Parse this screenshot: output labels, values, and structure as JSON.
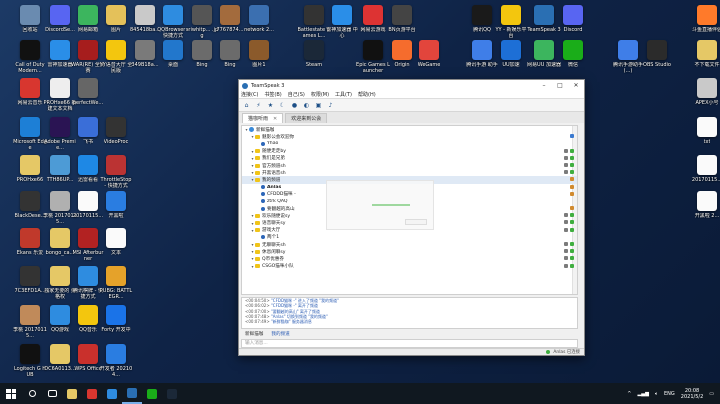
{
  "desktop": {
    "icons": [
      {
        "label": "回收站",
        "color": "#6a8bb0"
      },
      {
        "label": "DiscordSe...",
        "color": "#5865F2"
      },
      {
        "label": "网易邮箱",
        "color": "#3cb55e"
      },
      {
        "label": "图片",
        "color": "#e4c15a"
      },
      {
        "label": "845418ba...",
        "color": "#c9c9c9"
      },
      {
        "label": "QQBrowser - 快捷方式",
        "color": "#2e8ce0"
      },
      {
        "label": "sriwhitp... .jpg",
        "color": "#555"
      },
      {
        "label": "7767874...",
        "color": "#a36b3d"
      },
      {
        "label": "network 2...",
        "color": "#3b6fb0"
      },
      {
        "label": "Battlestate Games L...",
        "color": "#333"
      },
      {
        "label": "雷神加速器 中心",
        "color": "#2a8ee8"
      },
      {
        "label": "网易云游戏",
        "color": "#d33"
      },
      {
        "label": "BN页游平台",
        "color": "#444"
      },
      {
        "label": "腾讯QQ",
        "color": "#1a1a1a"
      },
      {
        "label": "YY - 新娱乐平台",
        "color": "#f3c60e"
      },
      {
        "label": "TeamSpeak 3",
        "color": "#2a6fb3"
      },
      {
        "label": "Discord",
        "color": "#5865F2"
      },
      {
        "label": "斗鱼直播伴侣",
        "color": "#ff7a2a"
      },
      {
        "label": "Call of Duty Modern...",
        "color": "#111"
      },
      {
        "label": "雷神加速器",
        "color": "#2a8ee8"
      },
      {
        "label": "WAR(RE) 全民赛",
        "color": "#a61d1d"
      },
      {
        "label": "YY语音大厅 全民版",
        "color": "#f3c60e"
      },
      {
        "label": "349B18a...",
        "color": "#7a7a7a"
      },
      {
        "label": "桌面",
        "color": "#2277cc"
      },
      {
        "label": "Bing",
        "color": "#6b6b6b"
      },
      {
        "label": "Bing",
        "color": "#6b6b6b"
      },
      {
        "label": "图片1",
        "color": "#8b5a2b"
      },
      {
        "label": "Steam",
        "color": "#1b2838"
      },
      {
        "label": "Epic Games Launcher",
        "color": "#111"
      },
      {
        "label": "Origin",
        "color": "#f56c2d"
      },
      {
        "label": "WeGame",
        "color": "#e2453c"
      },
      {
        "label": "腾讯手游 助手",
        "color": "#3f7ee8"
      },
      {
        "label": "UU加速",
        "color": "#1d6fd6"
      },
      {
        "label": "网易UU 加速器",
        "color": "#3cb55e"
      },
      {
        "label": "微信",
        "color": "#1aad19"
      },
      {
        "label": "腾讯手游助手(...)",
        "color": "#3f7ee8"
      },
      {
        "label": "OBS Studio",
        "color": "#2b2b2b"
      },
      {
        "label": "不下载文件",
        "color": "#e5c866"
      },
      {
        "label": "网易云音乐",
        "color": "#d8362f"
      },
      {
        "label": "PROHxe66 新建文本文档",
        "color": "#eeeeee"
      },
      {
        "label": "perfectWe...",
        "color": "#666"
      },
      {
        "label": "APEX小号",
        "color": "#c9c9c9"
      },
      {
        "label": "Microsoft Edge",
        "color": "#1d7fd6"
      },
      {
        "label": "Adobe Premie...",
        "color": "#2a1453"
      },
      {
        "label": "飞书",
        "color": "#3a6ed8"
      },
      {
        "label": "VideoProc",
        "color": "#333"
      },
      {
        "label": "txt",
        "color": "#fafafa"
      },
      {
        "label": "PROHxe66",
        "color": "#e5c866"
      },
      {
        "label": "TTH86UP...",
        "color": "#4d9bd6"
      },
      {
        "label": "迅雷看看",
        "color": "#1e88e5"
      },
      {
        "label": "ThrottleStop - 快捷方式",
        "color": "#b33"
      },
      {
        "label": "20170115...",
        "color": "#fafafa"
      },
      {
        "label": "BlackDese...",
        "color": "#333"
      },
      {
        "label": "李桃 20170115...",
        "color": "#b0b0b0"
      },
      {
        "label": "20170115...",
        "color": "#fafafa"
      },
      {
        "label": "开黑啦",
        "color": "#2a7de1"
      },
      {
        "label": "开黑啦 2...",
        "color": "#fafafa"
      },
      {
        "label": "Ekans 乐爱",
        "color": "#c0392b"
      },
      {
        "label": "bongo_ca...",
        "color": "#e5c866"
      },
      {
        "label": "MSI Afterburner",
        "color": "#b22222"
      },
      {
        "label": "文本",
        "color": "#fafafa"
      },
      {
        "label": "7C3EFD1A...",
        "color": "#333"
      },
      {
        "label": "独家无要的 资格权",
        "color": "#e5c866"
      },
      {
        "label": "腾讯棋牌 - 快捷方式",
        "color": "#2e8ce0"
      },
      {
        "label": "PUBG: BATTLEGR...",
        "color": "#e5a22a"
      },
      {
        "label": "李桃 20170115...",
        "color": "#c08a5a"
      },
      {
        "label": "QQ游戏",
        "color": "#2e8ce0"
      },
      {
        "label": "QQ音乐",
        "color": "#f3c60e"
      },
      {
        "label": "Forty 开发中",
        "color": "#1a73e8"
      },
      {
        "label": "Logitech G HUB",
        "color": "#111"
      },
      {
        "label": "DC6A0113...",
        "color": "#e5c866"
      },
      {
        "label": "WPS Office",
        "color": "#c9302c"
      },
      {
        "label": "开发者 202104...",
        "color": "#2a7de1"
      }
    ]
  },
  "window": {
    "title": "TeamSpeak 3",
    "menu": [
      "连接(C)",
      "书签(B)",
      "自己(S)",
      "权限(M)",
      "工具(T)",
      "帮助(H)"
    ],
    "tabs": [
      {
        "label": "猫咖听雨",
        "active": true
      },
      {
        "label": "欢迎来到公会",
        "active": false
      }
    ],
    "tree": [
      {
        "type": "server",
        "label": "新鲜猫咖",
        "bold": false
      },
      {
        "type": "channel",
        "label": "魅影公会欢迎你",
        "flags": [
          "info"
        ]
      },
      {
        "type": "user",
        "label": "Yhao",
        "indent": 2
      },
      {
        "type": "channel",
        "label": "随便走走by",
        "flags": [
          "lock",
          "ok"
        ]
      },
      {
        "type": "channel",
        "label": "我们是兄弟",
        "flags": [
          "lock",
          "ok"
        ]
      },
      {
        "type": "channel",
        "label": "官方频道sh",
        "flags": [
          "lock",
          "ok"
        ]
      },
      {
        "type": "channel",
        "label": "开黑语音sh",
        "flags": [
          "lock",
          "ok"
        ]
      },
      {
        "type": "channel",
        "label": "我的频道",
        "selected": true,
        "flags": [
          "mod"
        ]
      },
      {
        "type": "user",
        "label": "Anlas",
        "indent": 2,
        "bold": true,
        "flags": [
          "mod"
        ]
      },
      {
        "type": "user",
        "label": "CFDDD猫咪 -",
        "indent": 2,
        "flags": [
          "mod"
        ]
      },
      {
        "type": "user",
        "label": "ztrk QAQ",
        "indent": 2
      },
      {
        "type": "user",
        "label": "要翻越的高山",
        "indent": 2,
        "flags": [
          "mod"
        ]
      },
      {
        "type": "channel",
        "label": "欢乐随便说sy",
        "flags": [
          "lock",
          "ok"
        ]
      },
      {
        "type": "channel",
        "label": "语音聊天sy",
        "flags": [
          "lock",
          "ok"
        ]
      },
      {
        "type": "channel",
        "label": "游戏大厅",
        "flags": [
          "lock",
          "ok"
        ]
      },
      {
        "type": "user",
        "label": "两个1",
        "indent": 2
      },
      {
        "type": "channel",
        "label": "无聊聊天sh",
        "flags": [
          "lock",
          "ok"
        ]
      },
      {
        "type": "channel",
        "label": "休息闲聊sy",
        "flags": [
          "lock",
          "ok"
        ]
      },
      {
        "type": "channel",
        "label": "Q币优惠券",
        "flags": [
          "lock",
          "ok"
        ]
      },
      {
        "type": "channel",
        "label": "CSGO猫咪小队",
        "flags": [
          "lock",
          "ok"
        ]
      }
    ],
    "log": [
      {
        "time": "<00:04:50>",
        "text": "\"CFDD猫咪 -\" 进入了频道 \"我的频道\""
      },
      {
        "time": "<00:06:02>",
        "text": "\"CFDD猫咪 -\" 离开了频道"
      },
      {
        "time": "<00:07:00>",
        "text": "\"要翻越的高山\" 离开了频道"
      },
      {
        "time": "<00:07:48>",
        "text": "\"Anlas\" 切换到频道 \"我的频道\""
      },
      {
        "time": "<00:07:49>",
        "text": "\"新鲜猫咖\" 服务器消息"
      }
    ],
    "chat_tabs": [
      {
        "label": "新鲜猫咖",
        "active": false
      },
      {
        "label": "我的频道",
        "active": true
      }
    ],
    "chat_placeholder": "输入消息...",
    "status_text": "已连接",
    "status_user": "Anlas"
  },
  "taskbar": {
    "items": [
      {
        "name": "search",
        "color": "#ffffff"
      },
      {
        "name": "task-view",
        "color": "#ffffff"
      },
      {
        "name": "file-explorer",
        "color": "#e5c866"
      },
      {
        "name": "netease-music",
        "color": "#d8362f"
      },
      {
        "name": "qq",
        "color": "#2e8ce0"
      },
      {
        "name": "teamspeak",
        "color": "#2a6fb3",
        "open": true
      },
      {
        "name": "wechat",
        "color": "#1aad19"
      },
      {
        "name": "steam",
        "color": "#1b2838"
      }
    ],
    "clock_time": "20:08",
    "clock_date": "2021/5/2",
    "lang": "ENG"
  }
}
